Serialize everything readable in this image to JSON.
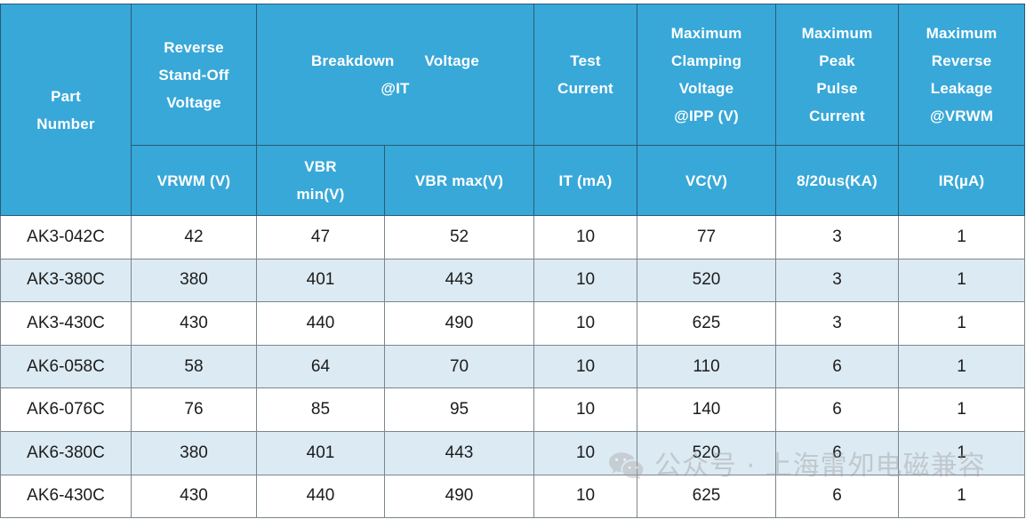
{
  "table": {
    "colors": {
      "header_blue": "#38A8D8",
      "alt_row": "#DCEAF3",
      "row_white": "#FFFFFF",
      "header_text": "#FFFFFF",
      "body_text": "#1C1C1C",
      "header_border": "#2A5B73",
      "body_border": "#7B868C"
    },
    "header_group": {
      "part_number": "Part\nNumber",
      "part_number_line1": "Part",
      "part_number_line2": "Number",
      "reverse_standoff_line1": "Reverse",
      "reverse_standoff_line2": "Stand-Off",
      "reverse_standoff_line3": "Voltage",
      "breakdown_line1_a": "Breakdown",
      "breakdown_line1_b": "Voltage",
      "breakdown_line2": "@IT",
      "test_current_line1": "Test",
      "test_current_line2": "Current",
      "max_clamping_line1": "Maximum",
      "max_clamping_line2": "Clamping",
      "max_clamping_line3": "Voltage",
      "max_clamping_line4": "@IPP (V)",
      "max_peak_line1": "Maximum",
      "max_peak_line2": "Peak",
      "max_peak_line3": "Pulse",
      "max_peak_line4": "Current",
      "max_leakage_line1": "Maximum",
      "max_leakage_line2": "Reverse",
      "max_leakage_line3": "Leakage",
      "max_leakage_line4": "@VRWM"
    },
    "header_units": {
      "vrwm": "VRWM (V)",
      "vbr_min_line1": "VBR",
      "vbr_min_line2": "min(V)",
      "vbr_max": "VBR max(V)",
      "it": "IT (mA)",
      "vc": "VC(V)",
      "ipp": "8/20us(KA)",
      "ir": "IR(µA)"
    },
    "columns": [
      "Part Number",
      "VRWM (V)",
      "VBR min(V)",
      "VBR max(V)",
      "IT (mA)",
      "VC(V)",
      "8/20us(KA)",
      "IR(µA)"
    ],
    "rows": [
      {
        "part": "AK3-042C",
        "vrwm": "42",
        "vbr_min": "47",
        "vbr_max": "52",
        "it": "10",
        "vc": "77",
        "ipp": "3",
        "ir": "1"
      },
      {
        "part": "AK3-380C",
        "vrwm": "380",
        "vbr_min": "401",
        "vbr_max": "443",
        "it": "10",
        "vc": "520",
        "ipp": "3",
        "ir": "1"
      },
      {
        "part": "AK3-430C",
        "vrwm": "430",
        "vbr_min": "440",
        "vbr_max": "490",
        "it": "10",
        "vc": "625",
        "ipp": "3",
        "ir": "1"
      },
      {
        "part": "AK6-058C",
        "vrwm": "58",
        "vbr_min": "64",
        "vbr_max": "70",
        "it": "10",
        "vc": "110",
        "ipp": "6",
        "ir": "1"
      },
      {
        "part": "AK6-076C",
        "vrwm": "76",
        "vbr_min": "85",
        "vbr_max": "95",
        "it": "10",
        "vc": "140",
        "ipp": "6",
        "ir": "1"
      },
      {
        "part": "AK6-380C",
        "vrwm": "380",
        "vbr_min": "401",
        "vbr_max": "443",
        "it": "10",
        "vc": "520",
        "ipp": "6",
        "ir": "1"
      },
      {
        "part": "AK6-430C",
        "vrwm": "430",
        "vbr_min": "440",
        "vbr_max": "490",
        "it": "10",
        "vc": "625",
        "ipp": "6",
        "ir": "1"
      }
    ]
  },
  "watermark": {
    "icon": "wechat-icon",
    "text": "公众号 · 上海雷夘电磁兼容",
    "color": "#9A9A9A"
  }
}
